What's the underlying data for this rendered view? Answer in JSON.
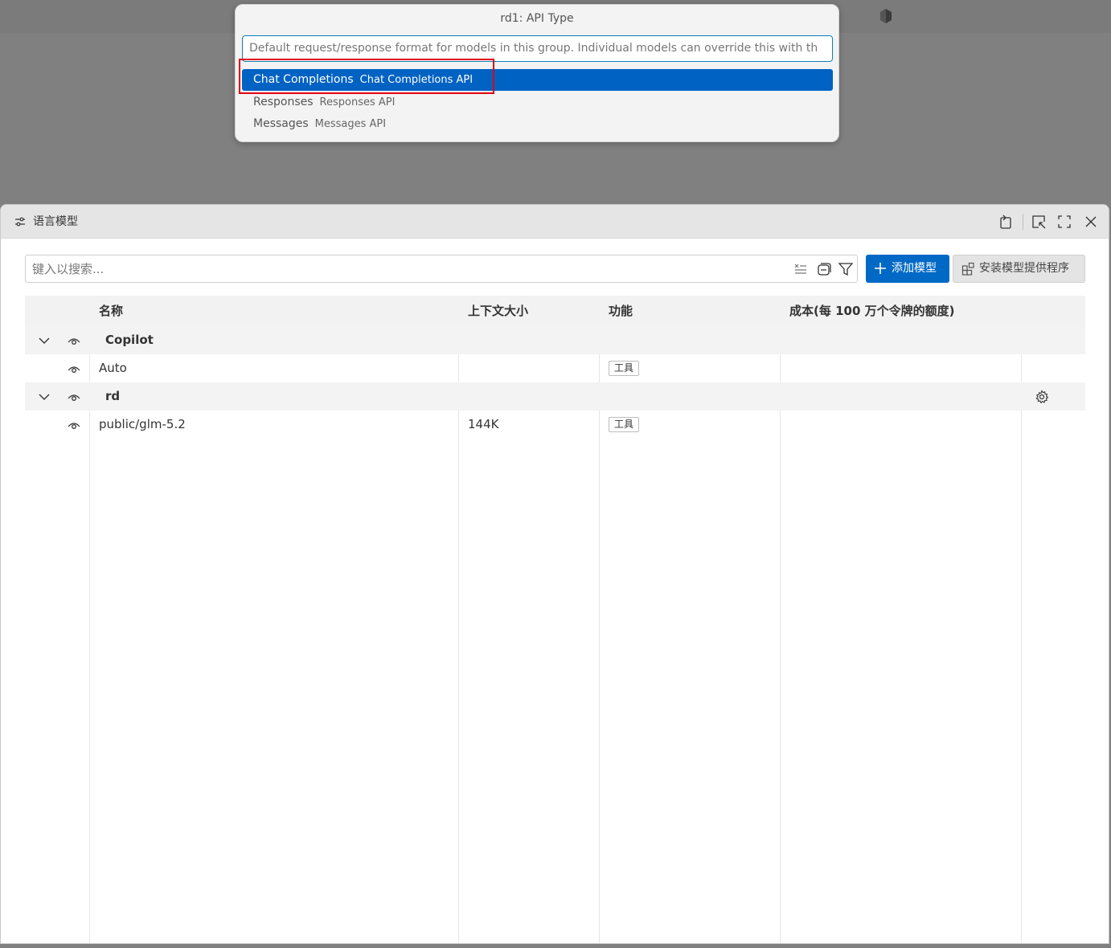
{
  "quickpick": {
    "title": "rd1: API Type",
    "input_value": "Default request/response format for models in this group. Individual models can override this with th",
    "items": [
      {
        "label": "Chat Completions",
        "description": "Chat Completions API",
        "selected": true
      },
      {
        "label": "Responses",
        "description": "Responses API",
        "selected": false
      },
      {
        "label": "Messages",
        "description": "Messages API",
        "selected": false
      }
    ]
  },
  "panel": {
    "title": "语言模型",
    "search_placeholder": "键入以搜索...",
    "add_model_label": "添加模型",
    "install_provider_label": "安装模型提供程序"
  },
  "table": {
    "headers": {
      "name": "名称",
      "context": "上下文大小",
      "capabilities": "功能",
      "cost": "成本(每 100 万个令牌的额度)"
    },
    "rows": [
      {
        "type": "group",
        "name": "Copilot",
        "context": "",
        "tag": ""
      },
      {
        "type": "model",
        "name": "Auto",
        "context": "",
        "tag": "工具"
      },
      {
        "type": "group",
        "name": "rd",
        "context": "",
        "tag": ""
      },
      {
        "type": "model",
        "name": "public/glm-5.2",
        "context": "144K",
        "tag": "工具"
      }
    ]
  },
  "colors": {
    "accent": "#0069c6",
    "selection": "#0062c3",
    "highlight_box": "#e00012"
  }
}
